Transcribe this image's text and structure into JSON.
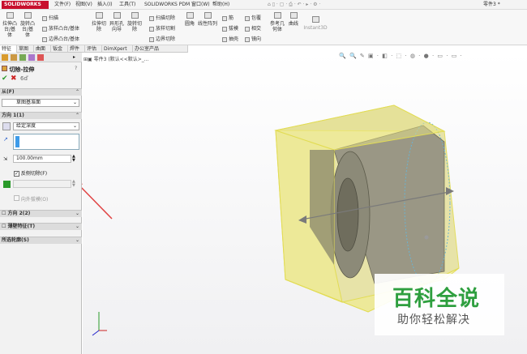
{
  "app": {
    "logo": "SOLIDWORKS",
    "title": "零件3 *"
  },
  "menu": [
    "文件(F)",
    "视图(V)",
    "插入(I)",
    "工具(T)",
    "SOLIDWORKS PDM",
    "窗口(W)",
    "帮助(H)"
  ],
  "ribbon": {
    "big": [
      {
        "label": "拉伸凸台/基体"
      },
      {
        "label": "旋转凸台/基体"
      },
      {
        "label": "拉伸切除"
      },
      {
        "label": "异形孔向导"
      },
      {
        "label": "旋转切除"
      },
      {
        "label": "圆角"
      },
      {
        "label": "线性阵列"
      },
      {
        "label": "参考几何体"
      },
      {
        "label": "曲线"
      },
      {
        "label": "Instant3D"
      }
    ],
    "small": [
      "扫描",
      "放样凸台/基体",
      "边界凸台/基体",
      "扫描切除",
      "放样切割",
      "边界切除",
      "筋",
      "拔模",
      "抽壳",
      "包覆",
      "相交",
      "镜向"
    ]
  },
  "tabs": [
    "特征",
    "草图",
    "曲面",
    "钣金",
    "焊件",
    "评估",
    "DimXpert",
    "办公室产品"
  ],
  "panel": {
    "feature_name": "切除-拉伸",
    "help": "?",
    "from": {
      "title": "从(F)",
      "value": "草图基准面"
    },
    "direction1": {
      "title": "方向 1(1)",
      "end_condition": "给定深度",
      "depth": "100.00mm",
      "flip_side": "反侧切除(F)",
      "outward_draft": "向外拔模(O)"
    },
    "direction2": "方向 2(2)",
    "thin_feature": "薄壁特征(T)",
    "selected_contours": "所选轮廓(S)"
  },
  "tree": {
    "label": "零件3 (默认<<默认>_..."
  },
  "watermark": {
    "title": "百科全说",
    "subtitle": "助你轻松解决"
  },
  "colors": {
    "accent": "#c8102e",
    "highlight": "#f3ef8a",
    "panel_header": "#dcdcdc"
  }
}
